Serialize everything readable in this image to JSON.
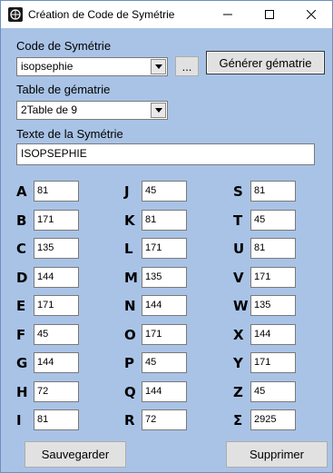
{
  "window": {
    "title": "Création de Code de Symétrie",
    "min_glyph": "—",
    "max_glyph": "☐",
    "close_glyph": "✕"
  },
  "form": {
    "code_label": "Code de Symétrie",
    "code_value": "isopsephie",
    "browse_label": "...",
    "generate_label": "Générer gématrie",
    "table_label": "Table de gématrie",
    "table_value": "2Table de 9",
    "text_label": "Texte de la Symétrie",
    "text_value": "ISOPSEPHIE"
  },
  "columns": [
    [
      {
        "letter": "A",
        "value": "81"
      },
      {
        "letter": "B",
        "value": "171"
      },
      {
        "letter": "C",
        "value": "135"
      },
      {
        "letter": "D",
        "value": "144"
      },
      {
        "letter": "E",
        "value": "171"
      },
      {
        "letter": "F",
        "value": "45"
      },
      {
        "letter": "G",
        "value": "144"
      },
      {
        "letter": "H",
        "value": "72"
      },
      {
        "letter": "I",
        "value": "81"
      }
    ],
    [
      {
        "letter": "J",
        "value": "45"
      },
      {
        "letter": "K",
        "value": "81"
      },
      {
        "letter": "L",
        "value": "171"
      },
      {
        "letter": "M",
        "value": "135"
      },
      {
        "letter": "N",
        "value": "144"
      },
      {
        "letter": "O",
        "value": "171"
      },
      {
        "letter": "P",
        "value": "45"
      },
      {
        "letter": "Q",
        "value": "144"
      },
      {
        "letter": "R",
        "value": "72"
      }
    ],
    [
      {
        "letter": "S",
        "value": "81"
      },
      {
        "letter": "T",
        "value": "45"
      },
      {
        "letter": "U",
        "value": "81"
      },
      {
        "letter": "V",
        "value": "171"
      },
      {
        "letter": "W",
        "value": "135"
      },
      {
        "letter": "X",
        "value": "144"
      },
      {
        "letter": "Y",
        "value": "171"
      },
      {
        "letter": "Z",
        "value": "45"
      },
      {
        "letter": "Σ",
        "value": "2925"
      }
    ]
  ],
  "footer": {
    "save_label": "Sauvegarder",
    "delete_label": "Supprimer"
  },
  "colors": {
    "window_bg": "#a9c3e6",
    "titlebar_bg": "#ffffff",
    "button_bg": "#e1e1e1"
  }
}
